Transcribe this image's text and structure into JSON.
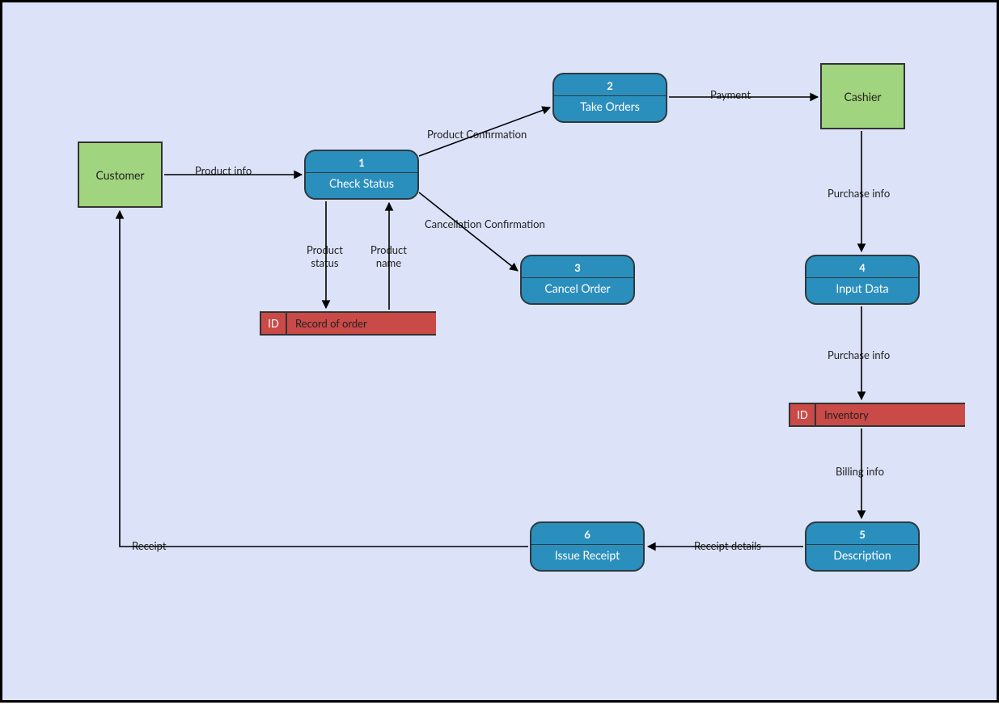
{
  "entities": {
    "customer": "Customer",
    "cashier": "Cashier"
  },
  "processes": {
    "p1": {
      "num": "1",
      "label": "Check Status"
    },
    "p2": {
      "num": "2",
      "label": "Take Orders"
    },
    "p3": {
      "num": "3",
      "label": "Cancel Order"
    },
    "p4": {
      "num": "4",
      "label": "Input Data"
    },
    "p5": {
      "num": "5",
      "label": "Description"
    },
    "p6": {
      "num": "6",
      "label": "Issue Receipt"
    }
  },
  "datastores": {
    "d1": {
      "id": "ID",
      "label": "Record of order"
    },
    "d2": {
      "id": "ID",
      "label": "Inventory"
    }
  },
  "flows": {
    "product_info": "Product info",
    "product_confirmation": "Product Confirmation",
    "payment": "Payment",
    "cancellation_confirmation": "Cancellation Confirmation",
    "product_status": "Product\nstatus",
    "product_name": "Product\nname",
    "purchase_info1": "Purchase info",
    "purchase_info2": "Purchase info",
    "billing_info": "Billing info",
    "receipt_details": "Receipt details",
    "receipt": "Receipt"
  }
}
